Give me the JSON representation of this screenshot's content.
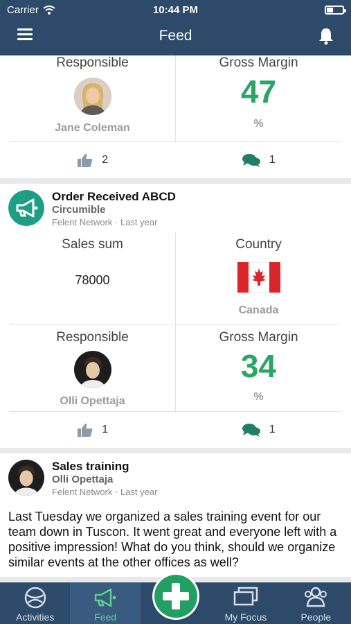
{
  "status": {
    "carrier": "Carrier",
    "time": "10:44 PM"
  },
  "nav": {
    "title": "Feed"
  },
  "card1": {
    "left_label": "Responsible",
    "person": "Jane Coleman",
    "right_label": "Gross Margin",
    "value": "47",
    "unit": "%",
    "likes": "2",
    "comments": "1"
  },
  "card2": {
    "title": "Order Received ABCD",
    "subtitle": "Circumible",
    "meta": "Felent Network · Last year",
    "sales_label": "Sales sum",
    "sales_value": "78000",
    "country_label": "Country",
    "country": "Canada",
    "resp_label": "Responsible",
    "person": "Olli Opettaja",
    "margin_label": "Gross Margin",
    "margin_value": "34",
    "unit": "%",
    "likes": "1",
    "comments": "1"
  },
  "card3": {
    "title": "Sales training",
    "author": "Olli Opettaja",
    "meta": "Felent Network · Last year",
    "body": "Last Tuesday we organized a sales training event for our team down in Tuscon. It went great and everyone left with a positive impression! What do you think, should we organize similar events at the other offices as well?"
  },
  "tabs": [
    {
      "label": "Activities",
      "icon": "ball-icon"
    },
    {
      "label": "Feed",
      "icon": "megaphone-icon"
    },
    {
      "label": "",
      "icon": "plus-icon"
    },
    {
      "label": "My Focus",
      "icon": "monitor-icon"
    },
    {
      "label": "People",
      "icon": "people-icon"
    }
  ],
  "colors": {
    "nav": "#2e4a6b",
    "accent": "#2aa566",
    "teal": "#1f9e86"
  }
}
